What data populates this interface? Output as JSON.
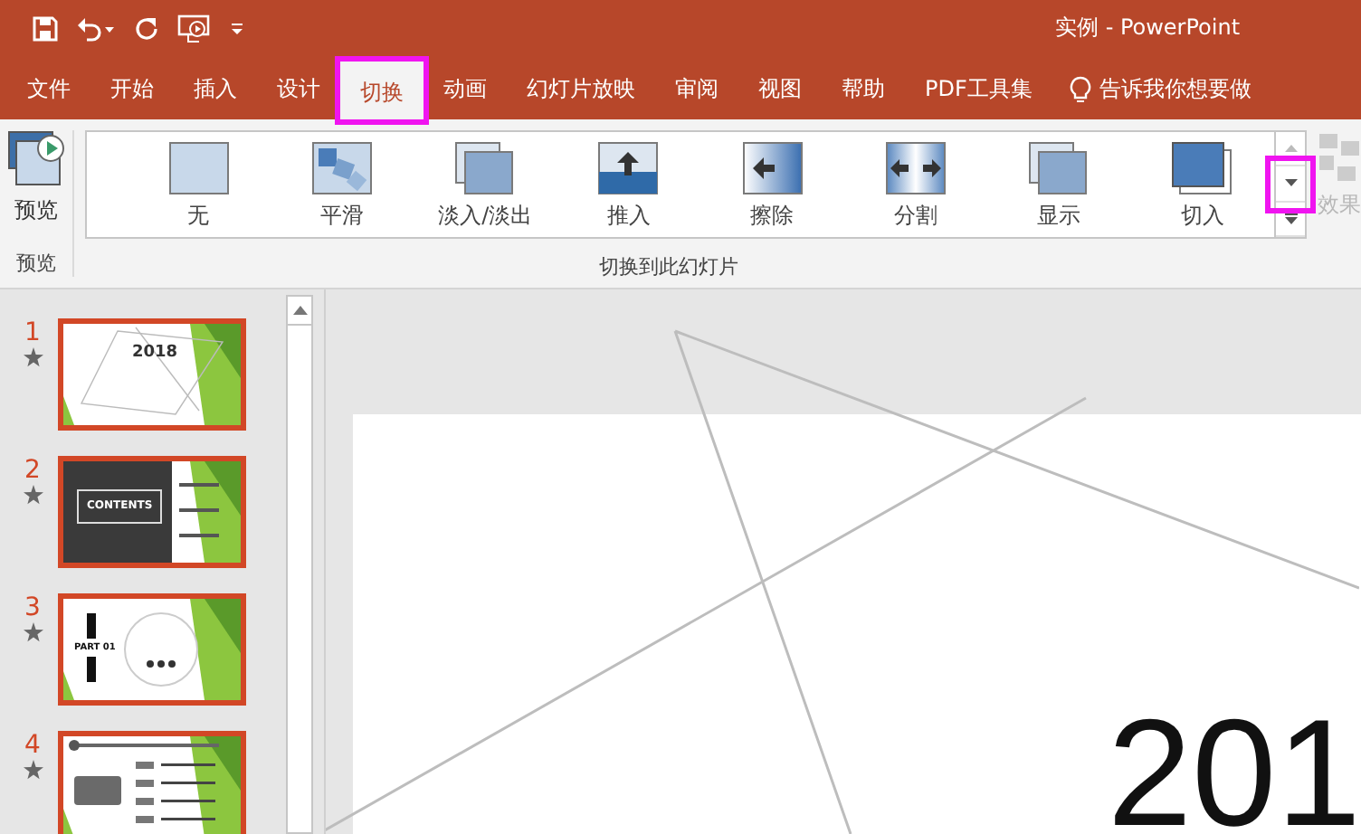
{
  "window": {
    "title": "实例  -  PowerPoint"
  },
  "tabs": [
    {
      "label": "文件",
      "selected": false,
      "highlighted": false
    },
    {
      "label": "开始",
      "selected": false,
      "highlighted": false
    },
    {
      "label": "插入",
      "selected": false,
      "highlighted": false
    },
    {
      "label": "设计",
      "selected": false,
      "highlighted": false
    },
    {
      "label": "切换",
      "selected": true,
      "highlighted": true
    },
    {
      "label": "动画",
      "selected": false,
      "highlighted": false
    },
    {
      "label": "幻灯片放映",
      "selected": false,
      "highlighted": false
    },
    {
      "label": "审阅",
      "selected": false,
      "highlighted": false
    },
    {
      "label": "视图",
      "selected": false,
      "highlighted": false
    },
    {
      "label": "帮助",
      "selected": false,
      "highlighted": false
    },
    {
      "label": "PDF工具集",
      "selected": false,
      "highlighted": false
    }
  ],
  "tell_me": {
    "placeholder": "告诉我你想要做"
  },
  "ribbon": {
    "preview": {
      "label": "预览",
      "group": "预览"
    },
    "transitions": [
      {
        "label": "无",
        "kind": "none"
      },
      {
        "label": "平滑",
        "kind": "morph"
      },
      {
        "label": "淡入/淡出",
        "kind": "fade"
      },
      {
        "label": "推入",
        "kind": "push"
      },
      {
        "label": "擦除",
        "kind": "wipe"
      },
      {
        "label": "分割",
        "kind": "split"
      },
      {
        "label": "显示",
        "kind": "reveal"
      },
      {
        "label": "切入",
        "kind": "cut"
      }
    ],
    "more_highlighted": true,
    "group": "切换到此幻灯片",
    "effects": {
      "label": "效果",
      "disabled": true
    }
  },
  "slides": [
    {
      "number": "1",
      "kind": "title",
      "title": "2018"
    },
    {
      "number": "2",
      "kind": "contents",
      "title": "CONTENTS"
    },
    {
      "number": "3",
      "kind": "part",
      "title": "PART 01"
    },
    {
      "number": "4",
      "kind": "timeline"
    }
  ],
  "slide": {
    "title": "201"
  }
}
